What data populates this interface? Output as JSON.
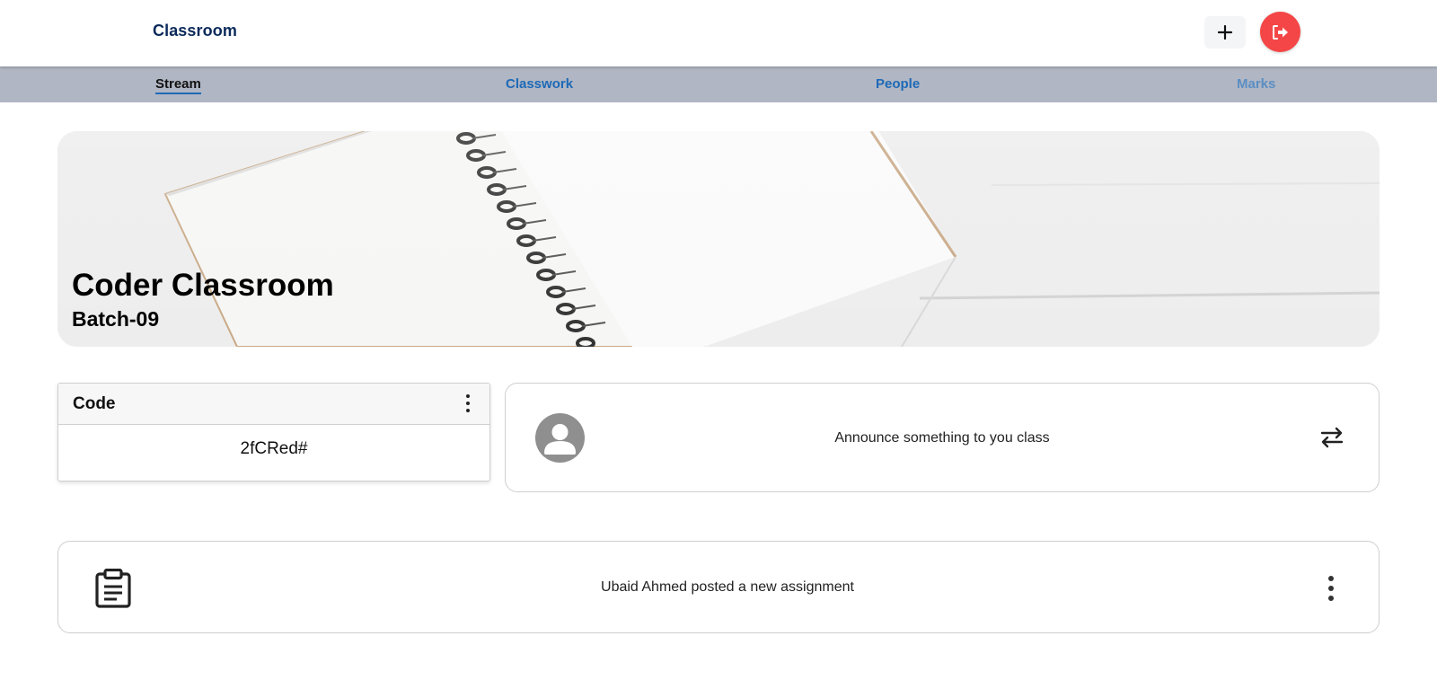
{
  "header": {
    "brand": "Classroom",
    "add_icon": "plus-icon",
    "logout_icon": "sign-out-icon"
  },
  "tabs": [
    {
      "label": "Stream",
      "active": true
    },
    {
      "label": "Classwork",
      "active": false
    },
    {
      "label": "People",
      "active": false
    },
    {
      "label": "Marks",
      "active": false
    }
  ],
  "banner": {
    "title": "Coder Classroom",
    "subtitle": "Batch-09"
  },
  "code_card": {
    "label": "Code",
    "value": "2fCRed#"
  },
  "announce": {
    "text": "Announce something to you class",
    "icon": "swap-arrows-icon"
  },
  "stream": {
    "items": [
      {
        "text": "Ubaid Ahmed posted a new assignment",
        "icon": "clipboard-icon"
      }
    ]
  },
  "colors": {
    "brand": "#0b2a5b",
    "tab_bar": "#b0b6c3",
    "tab_link": "#1e6ab7",
    "logout": "#f44646"
  }
}
